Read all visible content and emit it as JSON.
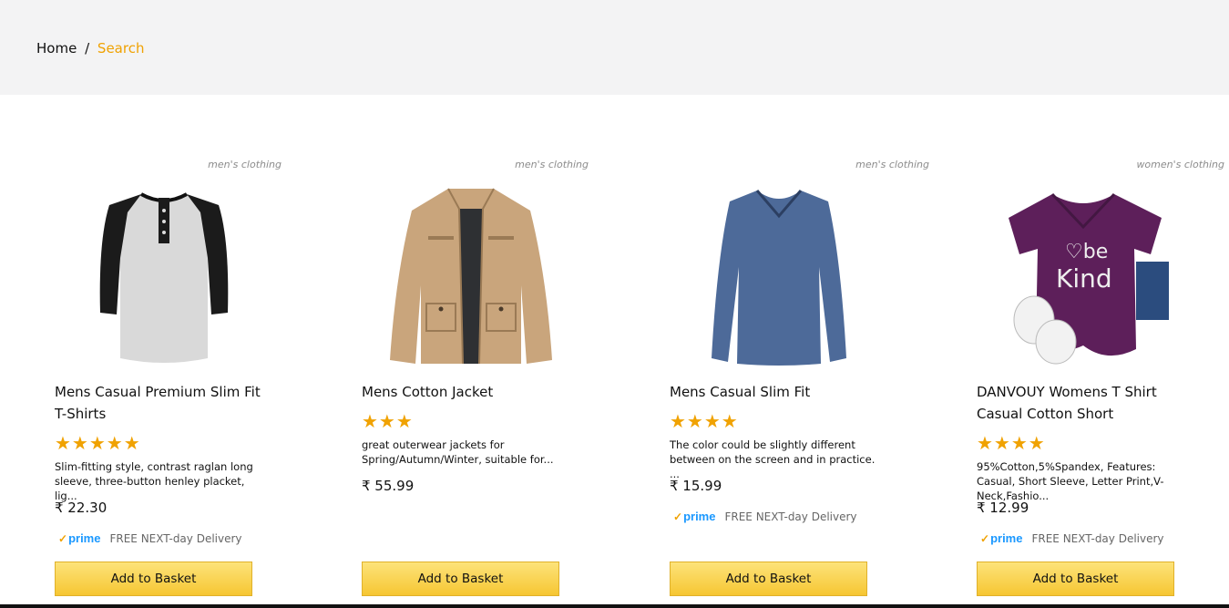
{
  "breadcrumb": {
    "home": "Home",
    "separator": "/",
    "current": "Search"
  },
  "products": [
    {
      "category": "men's clothing",
      "title": "Mens Casual Premium Slim Fit T-Shirts",
      "stars": "★★★★★",
      "description": "Slim-fitting style, contrast raglan long sleeve, three-button henley placket, lig...",
      "price": "₹ 22.30",
      "prime_logo": "prime",
      "prime_text": "FREE NEXT-day Delivery",
      "button": "Add to Basket"
    },
    {
      "category": "men's clothing",
      "title": "Mens Cotton Jacket",
      "stars": "★★★",
      "description": "great outerwear jackets for Spring/Autumn/Winter, suitable for...",
      "price": "₹ 55.99",
      "button": "Add to Basket"
    },
    {
      "category": "men's clothing",
      "title": "Mens Casual Slim Fit",
      "stars": "★★★★",
      "description": "The color could be slightly different between on the screen and in practice. ...",
      "price": "₹ 15.99",
      "prime_logo": "prime",
      "prime_text": "FREE NEXT-day Delivery",
      "button": "Add to Basket"
    },
    {
      "category": "women's clothing",
      "title": "DANVOUY Womens T Shirt Casual Cotton Short",
      "stars": "★★★★",
      "description": "95%Cotton,5%Spandex, Features: Casual, Short Sleeve, Letter Print,V-Neck,Fashio...",
      "price": "₹ 12.99",
      "prime_logo": "prime",
      "prime_text": "FREE NEXT-day Delivery",
      "button": "Add to Basket"
    }
  ],
  "colors": {
    "accent": "#f0a202",
    "prime_blue": "#1a98ff",
    "button": "#f6c632",
    "topbar": "#f3f3f4"
  }
}
